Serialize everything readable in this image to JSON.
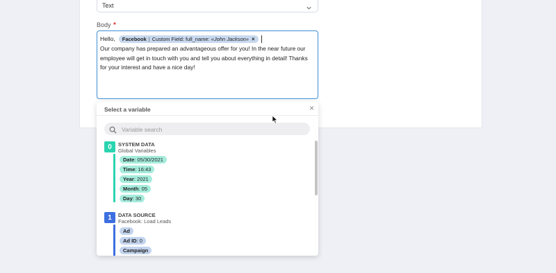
{
  "type_select": {
    "value": "Text"
  },
  "body_field": {
    "label": "Body",
    "required_mark": "*",
    "greeting": "Hello,",
    "chip": {
      "source": "Facebook",
      "separator": "|",
      "field": "Custom Field: full_name:",
      "value": "«John Jackson»",
      "remove": "×"
    },
    "text": "Our company has prepared an advantageous offer for you! In the near future our employee will get in touch with you and tell you about everything in detail! Thanks for your interest and have a nice day!"
  },
  "variable_panel": {
    "title": "Select a variable",
    "close": "×",
    "search_placeholder": "Variable search",
    "groups": [
      {
        "index": "0",
        "title": "SYSTEM DATA",
        "subtitle": "Global Variables",
        "color": "#2ad4b0",
        "pill_color": "#a5ecdc",
        "items": [
          {
            "key": "Date",
            "value": ": 05/30/2021"
          },
          {
            "key": "Time",
            "value": ": 16:43"
          },
          {
            "key": "Year",
            "value": ": 2021"
          },
          {
            "key": "Month",
            "value": ": 05"
          },
          {
            "key": "Day",
            "value": ": 30"
          }
        ]
      },
      {
        "index": "1",
        "title": "DATA SOURCE",
        "subtitle": "Facebook: Load Leads",
        "color": "#3d6fe0",
        "pill_color": "#c3d4ee",
        "items": [
          {
            "key": "Ad",
            "value": ""
          },
          {
            "key": "Ad ID",
            "value": ": 0"
          },
          {
            "key": "Campaign",
            "value": ""
          }
        ]
      }
    ]
  }
}
